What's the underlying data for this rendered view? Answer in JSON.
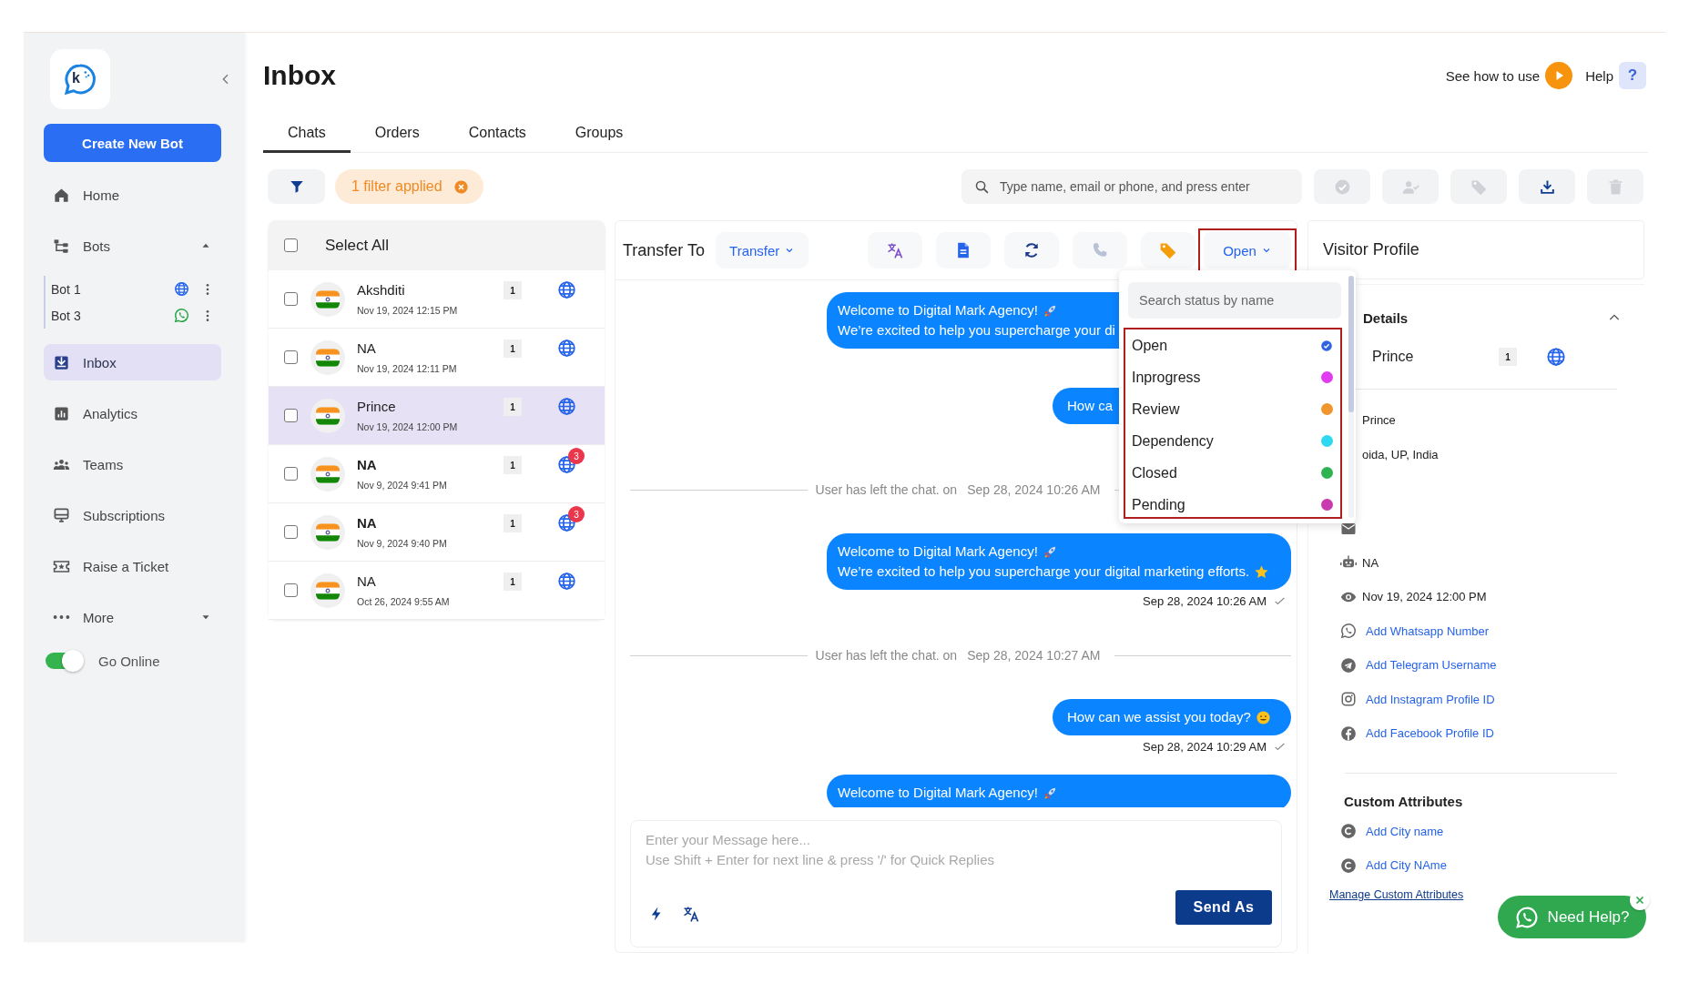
{
  "sidebar": {
    "logo_letter": "k",
    "create_button": "Create New Bot",
    "nav": [
      {
        "label": "Home",
        "selected": false
      },
      {
        "label": "Bots",
        "selected": false,
        "expanded": true,
        "children": [
          {
            "name": "Bot 1",
            "kind": "web"
          },
          {
            "name": "Bot 3",
            "kind": "whatsapp"
          }
        ]
      },
      {
        "label": "Inbox",
        "selected": true
      },
      {
        "label": "Analytics",
        "selected": false
      },
      {
        "label": "Teams",
        "selected": false
      },
      {
        "label": "Subscriptions",
        "selected": false
      },
      {
        "label": "Raise a Ticket",
        "selected": false
      },
      {
        "label": "More",
        "selected": false,
        "expanded": false
      }
    ],
    "online": {
      "label": "Go Online",
      "on": true
    }
  },
  "header": {
    "title": "Inbox",
    "how_to": "See how to use",
    "help": "Help",
    "help_glyph": "?"
  },
  "tabs": [
    {
      "label": "Chats",
      "selected": true
    },
    {
      "label": "Orders",
      "selected": false
    },
    {
      "label": "Contacts",
      "selected": false
    },
    {
      "label": "Groups",
      "selected": false
    }
  ],
  "filter": {
    "chip": "1 filter applied"
  },
  "search": {
    "placeholder": "Type name, email or phone, and press enter"
  },
  "actions": [
    {
      "disabled": true
    },
    {
      "disabled": true
    },
    {
      "disabled": true
    },
    {
      "disabled": false
    },
    {
      "disabled": true
    }
  ],
  "conversations": {
    "select_all": "Select All",
    "all_checked": false,
    "rows": [
      {
        "name": "Akshditi",
        "time": "Nov 19, 2024 12:15 PM",
        "count": "1",
        "checked": false,
        "selected": false,
        "unread": false
      },
      {
        "name": "NA",
        "time": "Nov 19, 2024 12:11 PM",
        "count": "1",
        "checked": false,
        "selected": false,
        "unread": false
      },
      {
        "name": "Prince",
        "time": "Nov 19, 2024 12:00 PM",
        "count": "1",
        "checked": false,
        "selected": true,
        "unread": false
      },
      {
        "name": "NA",
        "time": "Nov 9, 2024 9:41 PM",
        "count": "1",
        "checked": false,
        "selected": false,
        "unread": true,
        "badge": "3"
      },
      {
        "name": "NA",
        "time": "Nov 9, 2024 9:40 PM",
        "count": "1",
        "checked": false,
        "selected": false,
        "unread": true,
        "badge": "3"
      },
      {
        "name": "NA",
        "time": "Oct 26, 2024 9:55 AM",
        "count": "1",
        "checked": false,
        "selected": false,
        "unread": false
      }
    ]
  },
  "chat": {
    "transfer_label": "Transfer To",
    "transfer_button": "Transfer",
    "tools": [
      {
        "disabled": false
      },
      {
        "disabled": false
      },
      {
        "disabled": false
      },
      {
        "disabled": true
      },
      {
        "disabled": false
      }
    ],
    "status_button": "Open",
    "messages": [
      {
        "kind": "bubble",
        "lines": [
          {
            "text": "Welcome to Digital Mark Agency!",
            "kind": "rocket"
          },
          {
            "text": "We’re excited to help you supercharge your di",
            "kind": "plain"
          }
        ]
      },
      {
        "kind": "bubble",
        "lines": [
          {
            "text": "How ca",
            "kind": "plain"
          }
        ]
      },
      {
        "kind": "event",
        "text": "User has left the chat. on",
        "time": "Sep 28, 2024 10:26 AM"
      },
      {
        "kind": "bubble",
        "lines": [
          {
            "text": "Welcome to Digital Mark Agency!",
            "kind": "rocket"
          },
          {
            "text": "We’re excited to help you supercharge your digital marketing efforts.",
            "kind": "star"
          }
        ],
        "time": "Sep 28, 2024 10:26 AM"
      },
      {
        "kind": "event",
        "text": "User has left the chat. on",
        "time": "Sep 28, 2024 10:27 AM"
      },
      {
        "kind": "bubble",
        "lines": [
          {
            "text": "How can we assist you today?",
            "kind": "smiley"
          }
        ],
        "time": "Sep 28, 2024 10:29 AM"
      },
      {
        "kind": "bubble",
        "lines": [
          {
            "text": "Welcome to Digital Mark Agency!",
            "kind": "rocket"
          }
        ],
        "cut": true
      }
    ],
    "composer": {
      "placeholder": "Enter your Message here...\nUse Shift + Enter for next line & press '/' for Quick Replies",
      "send": "Send As"
    }
  },
  "status_menu": {
    "placeholder": "Search status by name",
    "options": [
      {
        "label": "Open",
        "color": "#2f63e0",
        "selected": true
      },
      {
        "label": "Inprogress",
        "color": "#e23cf0",
        "selected": false
      },
      {
        "label": "Review",
        "color": "#f0962c",
        "selected": false
      },
      {
        "label": "Dependency",
        "color": "#2ed8ee",
        "selected": false
      },
      {
        "label": "Closed",
        "color": "#2fb352",
        "selected": false
      },
      {
        "label": "Pending",
        "color": "#c93aae",
        "selected": false
      }
    ]
  },
  "profile": {
    "title": "Visitor Profile",
    "details_title": "Details",
    "name": "Prince",
    "count": "1",
    "fields": [
      {
        "kind": "name",
        "text": "Prince"
      },
      {
        "kind": "location",
        "text": "oida, UP, India"
      },
      {
        "kind": "email"
      },
      {
        "kind": "bot",
        "text": "NA"
      },
      {
        "kind": "seen",
        "text": "Nov 19, 2024 12:00 PM"
      },
      {
        "kind": "whatsapp",
        "text": "Add Whatsapp Number"
      },
      {
        "kind": "telegram",
        "text": "Add Telegram Username"
      },
      {
        "kind": "instagram",
        "text": "Add Instagram Profile ID"
      },
      {
        "kind": "facebook",
        "text": "Add Facebook Profile ID"
      }
    ],
    "custom_title": "Custom Attributes",
    "custom": [
      "Add City name",
      "Add City NAme"
    ],
    "manage": "Manage Custom Attributes"
  },
  "help_widget": {
    "label": "Need Help?"
  }
}
